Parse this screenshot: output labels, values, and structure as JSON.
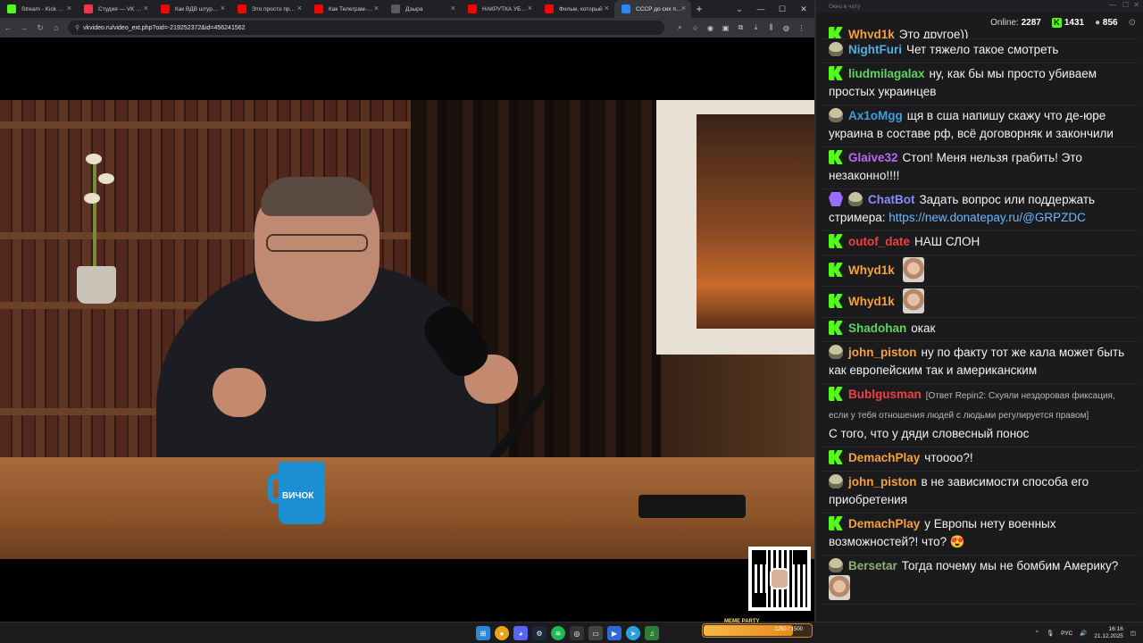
{
  "browser": {
    "tabs": [
      {
        "title": "Stream - Kick Dashboard",
        "color": "#53fc18"
      },
      {
        "title": "Студия — VK Видео",
        "color": "#ff3347"
      },
      {
        "title": "Как ВДВ штурмуют",
        "color": "#ff0000"
      },
      {
        "title": "Это просто провал",
        "color": "#ff0000"
      },
      {
        "title": "Как Телеграм-канал",
        "color": "#ff0000"
      },
      {
        "title": "Дзыра",
        "color": "#5a5a5a"
      },
      {
        "title": "НАКРУТКА УБИВАЕТ",
        "color": "#ff0000"
      },
      {
        "title": "Фильм, который",
        "color": "#ff0000"
      },
      {
        "title": "СССР до сих пор",
        "color": "#2787f5",
        "active": true
      }
    ],
    "url": "vkvideo.ru/video_ext.php?oid=-219252372&id=456241562"
  },
  "video": {
    "mug_text": "ВИЧОК"
  },
  "chat": {
    "window_title": "Окно в чату",
    "online_label": "Online:",
    "online_count": "2287",
    "kick_count": "1431",
    "twitch_count": "856",
    "messages": [
      {
        "badge": "kick",
        "user": "Whyd1k",
        "color": "#f6a23c",
        "text": "Это другое))"
      },
      {
        "badge": "twitch",
        "user": "NightFuri",
        "color": "#4fb0e8",
        "text": "Чет тяжело такое смотреть"
      },
      {
        "badge": "kick",
        "user": "liudmilagalax",
        "color": "#5cd65c",
        "text": "ну, как бы мы просто убиваем простых украинцев"
      },
      {
        "badge": "twitch",
        "user": "Ax1oMgg",
        "color": "#3fa0d8",
        "text": "щя в сша напишу скажу что де-юре украина в составе рф, всё договорняк и закончили"
      },
      {
        "badge": "kick",
        "user": "Glaive32",
        "color": "#b66cf0",
        "text": "Стоп! Меня нельзя грабить! Это незаконно!!!!"
      },
      {
        "badge": "bot",
        "user": "ChatBot",
        "color": "#8a8aff",
        "text": "Задать вопрос или поддержать стримера: ",
        "link": "https://new.donatepay.ru/@GRPZDC"
      },
      {
        "badge": "kick",
        "user": "outof_date",
        "color": "#f04040",
        "text": "НАШ СЛОН"
      },
      {
        "badge": "kick",
        "user": "Whyd1k",
        "color": "#f6a23c",
        "text": "",
        "emote": "photo"
      },
      {
        "badge": "kick",
        "user": "Whyd1k",
        "color": "#f6a23c",
        "text": "",
        "emote": "photo"
      },
      {
        "badge": "kick",
        "user": "Shadohan",
        "color": "#5cd65c",
        "text": "окак"
      },
      {
        "badge": "twitch",
        "user": "john_piston",
        "color": "#f6a23c",
        "text": "ну по факту тот же кала может быть как европейским так и американским"
      },
      {
        "badge": "kick",
        "user": "Bublgusman",
        "color": "#f04040",
        "reply": "[Ответ Repin2: Схуяли нездоровая фиксация, если у тебя отношения людей с людьми регулируется правом]",
        "text": "С того, что у дяди словесный понос"
      },
      {
        "badge": "kick",
        "user": "DemachPlay",
        "color": "#f6a23c",
        "text": "чтоооо?!"
      },
      {
        "badge": "twitch",
        "user": "john_piston",
        "color": "#f6a23c",
        "text": "в не зависимости способа его приобретения"
      },
      {
        "badge": "kick",
        "user": "DemachPlay",
        "color": "#f6a23c",
        "text": "у Европы нету военных возможностей?! что?",
        "emoji": "😍"
      },
      {
        "badge": "twitch",
        "user": "Bersetar",
        "color": "#8fb070",
        "text": "Тогда почему мы не бомбим Америку?",
        "emote": "photo"
      }
    ]
  },
  "taskbar": {
    "meme_label": "MEME PARTY",
    "meme_value": "1250 / 1500",
    "meme_progress": 0.83,
    "lang": "РУС",
    "time": "16:16",
    "date": "21.12.2025"
  }
}
